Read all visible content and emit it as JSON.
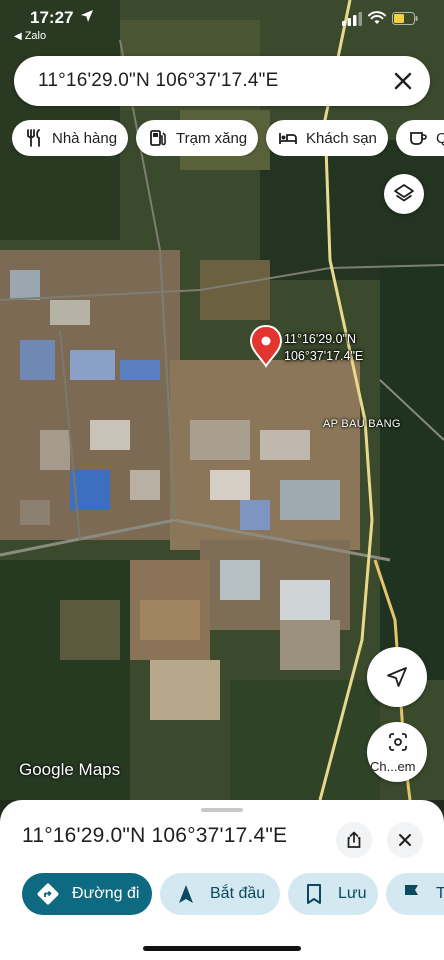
{
  "status_bar": {
    "time": "17:27",
    "back_app": "Zalo"
  },
  "search": {
    "query": "11°16'29.0\"N 106°37'17.4\"E"
  },
  "chips": [
    {
      "label": "Nhà hàng",
      "icon": "restaurant-icon"
    },
    {
      "label": "Trạm xăng",
      "icon": "gas-station-icon"
    },
    {
      "label": "Khách sạn",
      "icon": "hotel-icon"
    },
    {
      "label": "Q",
      "icon": "coffee-icon"
    }
  ],
  "map": {
    "view": "satellite",
    "pin": {
      "lat_label": "11°16'29.0\"N",
      "lng_label": "106°37'17.4\"E",
      "color": "#e3342f"
    },
    "place_label": "AP BAU BANG",
    "attribution": "Google Maps"
  },
  "buttons": {
    "camera_label": "Ch...em"
  },
  "sheet": {
    "title": "11°16'29.0\"N 106°37'17.4\"E",
    "actions": [
      {
        "label": "Đường đi",
        "icon": "directions-icon",
        "primary": true
      },
      {
        "label": "Bắt đầu",
        "icon": "navigation-arrow-icon",
        "primary": false
      },
      {
        "label": "Lưu",
        "icon": "bookmark-icon",
        "primary": false
      },
      {
        "label": "T",
        "icon": "flag-icon",
        "primary": false
      }
    ]
  },
  "colors": {
    "accent": "#0d6a80",
    "accent_light": "#d3e8f0",
    "pin": "#e3342f"
  }
}
